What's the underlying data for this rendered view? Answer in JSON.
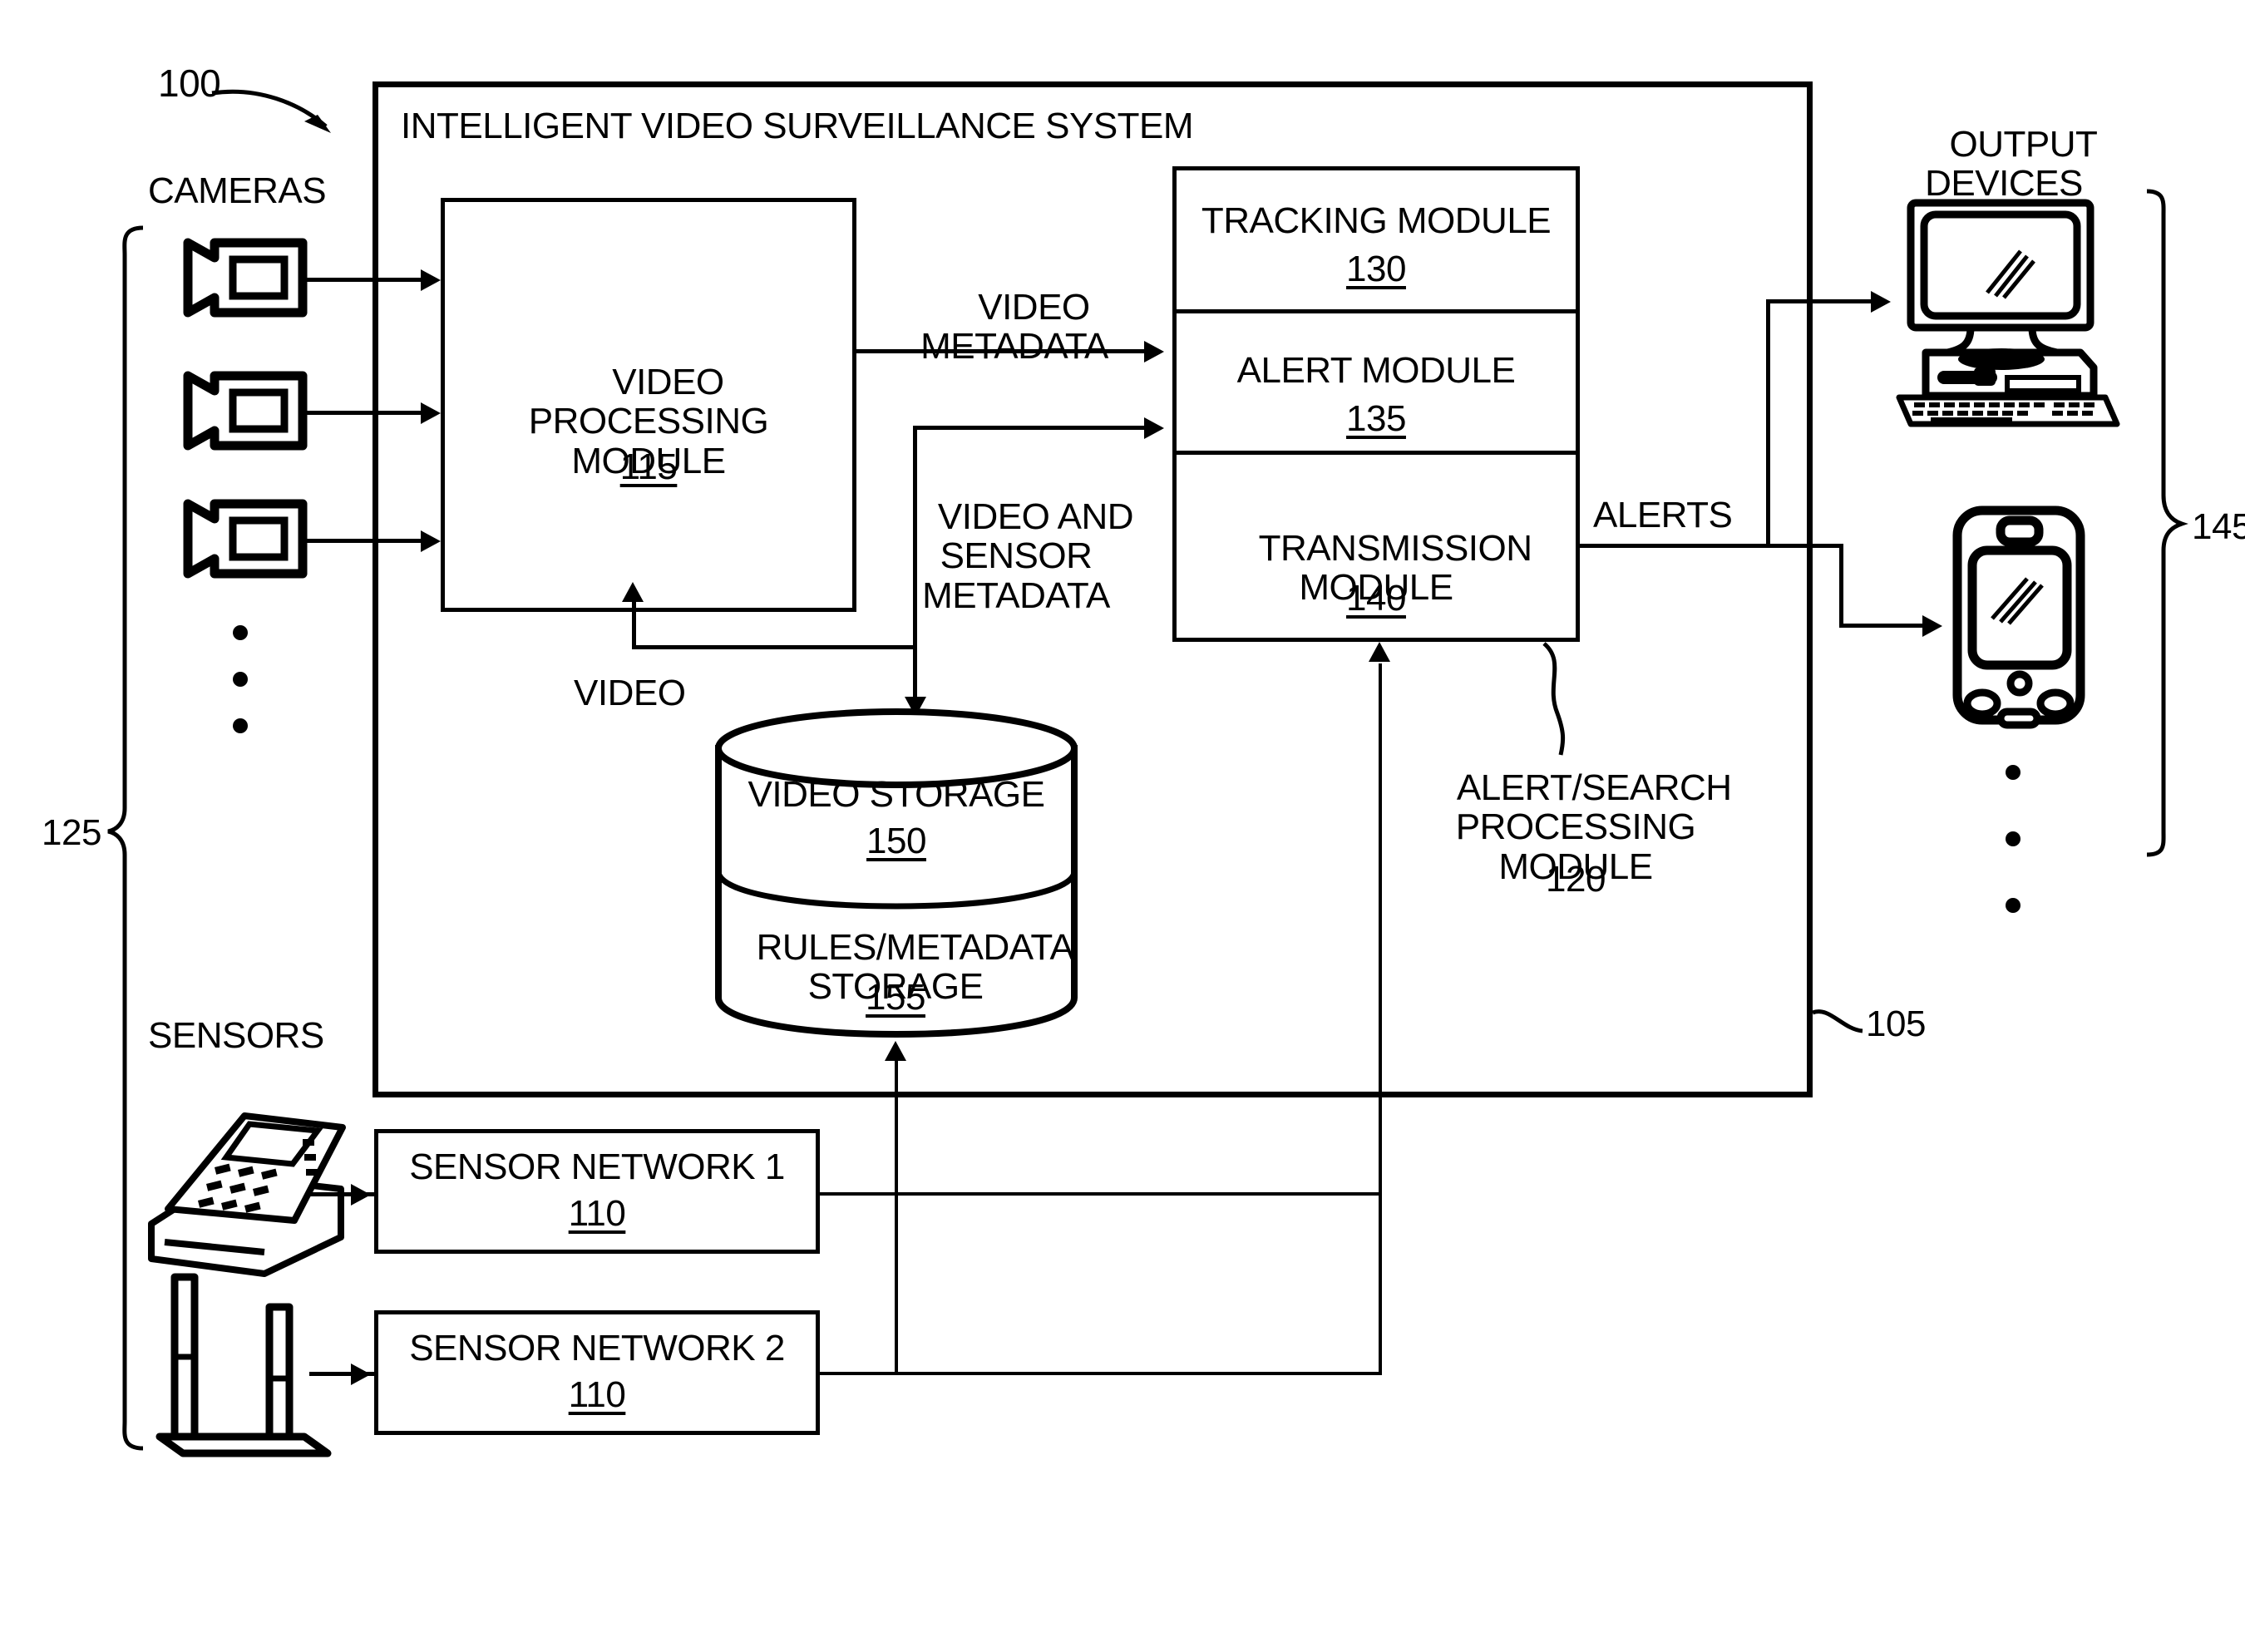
{
  "figure": {
    "ref_number": "100",
    "system_box_label": "INTELLIGENT VIDEO SURVEILLANCE SYSTEM",
    "system_box_ref": "105"
  },
  "groups": {
    "cameras_label": "CAMERAS",
    "sensors_label": "SENSORS",
    "output_devices_label": "OUTPUT\nDEVICES",
    "inputs_bracket_ref": "125",
    "outputs_bracket_ref": "145"
  },
  "blocks": {
    "video_processing": {
      "title": "VIDEO\nPROCESSING\nMODULE",
      "ref": "115",
      "underlined": true
    },
    "tracking": {
      "title": "TRACKING MODULE",
      "ref": "130",
      "underlined": true
    },
    "alert": {
      "title": "ALERT MODULE",
      "ref": "135",
      "underlined": true
    },
    "transmission": {
      "title": "TRANSMISSION\nMODULE",
      "ref": "140",
      "underlined": true
    },
    "alert_search_processing": {
      "title": "ALERT/SEARCH\nPROCESSING\nMODULE",
      "ref": "120",
      "underlined": false
    },
    "video_storage": {
      "title": "VIDEO STORAGE",
      "ref": "150",
      "underlined": true
    },
    "rules_metadata_storage": {
      "title": "RULES/METADATA\nSTORAGE",
      "ref": "155",
      "underlined": true
    },
    "sensor_network_1": {
      "title": "SENSOR NETWORK 1",
      "ref": "110",
      "underlined": true
    },
    "sensor_network_2": {
      "title": "SENSOR NETWORK 2",
      "ref": "110",
      "underlined": true
    }
  },
  "flows": {
    "video_metadata": "VIDEO\nMETADATA",
    "video_and_sensor_metadata": "VIDEO AND\nSENSOR\nMETADATA",
    "video": "VIDEO",
    "alerts": "ALERTS"
  },
  "icons": {
    "camera_1": "camera-icon",
    "camera_2": "camera-icon",
    "camera_3": "camera-icon",
    "camera_ellipsis": "vertical-ellipsis-icon",
    "sensor_keypad": "keypad-terminal-icon",
    "sensor_gate": "security-gate-icon",
    "output_computer": "desktop-computer-icon",
    "output_pda": "pda-handheld-icon",
    "output_ellipsis": "vertical-ellipsis-icon",
    "database": "database-cylinder-icon"
  },
  "colors": {
    "ink": "#000000",
    "paper": "#ffffff"
  }
}
